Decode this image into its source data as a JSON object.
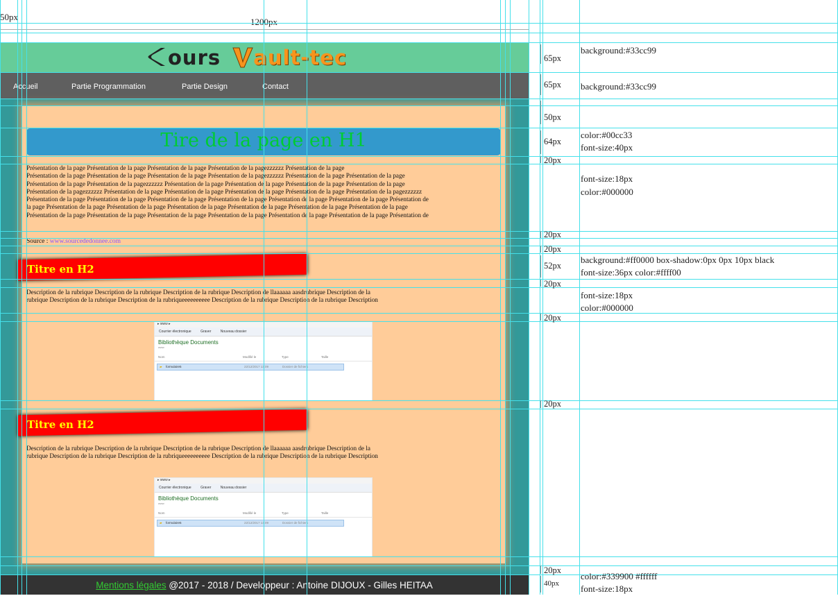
{
  "top_labels": {
    "margin_label": "50px",
    "width_label": "1200px"
  },
  "site": {
    "logo": {
      "part1": "ours",
      "part2": "ault-tec"
    },
    "nav": [
      "Accueil",
      "Partie Programmation",
      "Partie Design",
      "Contact"
    ],
    "h1": "Tire de la page en H1",
    "intro_lines": [
      "Présentation de la page Présentation de la page Présentation de la page Présentation de la pagezzzzzz Présentation de la page",
      "Présentation de la page Présentation de la page Présentation de la page Présentation de la pagezzzzzz Présentation de la page Présentation de la page",
      "Présentation de la page Présentation de la pagezzzzzz Présentation de la page Présentation de la page Présentation de la page Présentation de la page",
      "Présentation de la pagezzzzzz Présentation de la page Présentation de la page Présentation de la page Présentation de la page Présentation de la pagezzzzzz",
      "Présentation de la page Présentation de la page Présentation de la page Présentation de la page Présentation de la page Présentation de la page Présentation de",
      "la page Présentation de la page Présentation de la page Présentation de la page Présentation de la page Présentation de la page Présentation de la page",
      "Présentation de la page Présentation de la page Présentation de la page Présentation de la page Présentation de la page Présentation de la page Présentation de"
    ],
    "source_label": "Source :",
    "source_link": "www.sourcededonnee.com",
    "sections": [
      {
        "h2": "Titre en H2",
        "desc_lines": [
          "Description de la rubrique Description de la rubrique Description de la rubrique Description de llaaaaaa aasdrubrique Description de la",
          "rubrique Description de la rubrique Description de la rubriqueeeeeeeeee Description de la rubrique Description de la rubrique Description"
        ]
      },
      {
        "h2": "Titre en H2",
        "desc_lines": [
          "Description de la rubrique Description de la rubrique Description de la rubrique Description de llaaaaaa aasdrubrique Description de la",
          "rubrique Description de la rubrique Description de la rubriqueeeeeeeeee Description de la rubrique Description de la rubrique Description"
        ]
      }
    ],
    "screenshot": {
      "path": "▸ www ▸",
      "toolbar": [
        "Courrier électronique",
        "Graver",
        "Nouveau dossier"
      ],
      "library_title": "Bibliothèque Documents",
      "library_sub": "www",
      "columns": [
        "Nom",
        "Modifié le",
        "Type",
        "Taille"
      ],
      "row": {
        "name": "formulaire5",
        "date": "22/12/2017 13:09",
        "type": "Dossier de fichiers"
      }
    },
    "footer": {
      "link": "Mentions légales",
      "text": " @2017 - 2018 / Developpeur : Antoine DIJOUX - Gilles HEITAA"
    }
  },
  "dimensions": [
    "65px",
    "65px",
    "50px",
    "64px",
    "20px",
    "20px",
    "20px",
    "52px",
    "20px",
    "20px",
    "20px",
    "20px",
    "40px"
  ],
  "notes": {
    "header_bg": "background:#33cc99",
    "nav_bg": "background:#33cc99",
    "h1_color": "color:#00cc33",
    "h1_size": "font-size:40px",
    "p_size": "font-size:18px",
    "p_color": "color:#000000",
    "h2_bg": "background:#ff0000 box-shadow:0px 0px 10px black",
    "h2_font": "font-size:36px  color:#ffff00",
    "desc_size": "font-size:18px",
    "desc_color": "color:#000000",
    "footer_color": "color:#339900   #ffffff",
    "footer_size": "font-size:18px"
  }
}
